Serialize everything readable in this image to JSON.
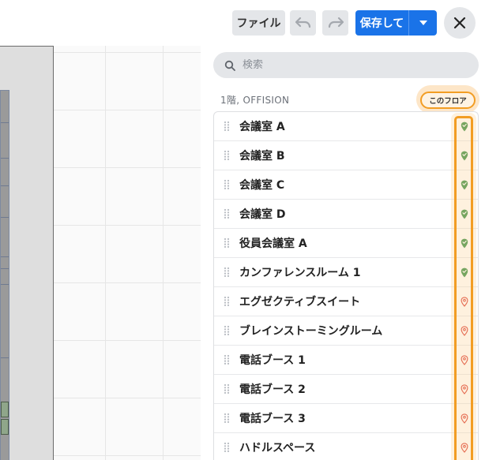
{
  "toolbar": {
    "file_label": "ファイル",
    "save_label": "保存して",
    "undo_icon": "undo-icon",
    "redo_icon": "redo-icon",
    "close_icon": "close-icon",
    "save_color": "#1a73e8"
  },
  "search": {
    "placeholder": "検索",
    "value": ""
  },
  "section": {
    "title": "1階, OFFISION",
    "badge": "このフロア",
    "badge_color": "#f29d24"
  },
  "rooms": [
    {
      "name": "会議室 A",
      "status": "placed"
    },
    {
      "name": "会議室 B",
      "status": "placed"
    },
    {
      "name": "会議室 C",
      "status": "placed"
    },
    {
      "name": "会議室 D",
      "status": "placed"
    },
    {
      "name": "役員会議室 A",
      "status": "placed"
    },
    {
      "name": "カンファレンスルーム 1",
      "status": "placed"
    },
    {
      "name": "エグゼクティブスイート",
      "status": "unplaced"
    },
    {
      "name": "ブレインストーミングルーム",
      "status": "unplaced"
    },
    {
      "name": "電話ブース 1",
      "status": "unplaced"
    },
    {
      "name": "電話ブース 2",
      "status": "unplaced"
    },
    {
      "name": "電話ブース 3",
      "status": "unplaced"
    },
    {
      "name": "ハドルスペース",
      "status": "unplaced"
    }
  ],
  "status_colors": {
    "placed": "#2e8b3e",
    "unplaced": "#d93025"
  }
}
